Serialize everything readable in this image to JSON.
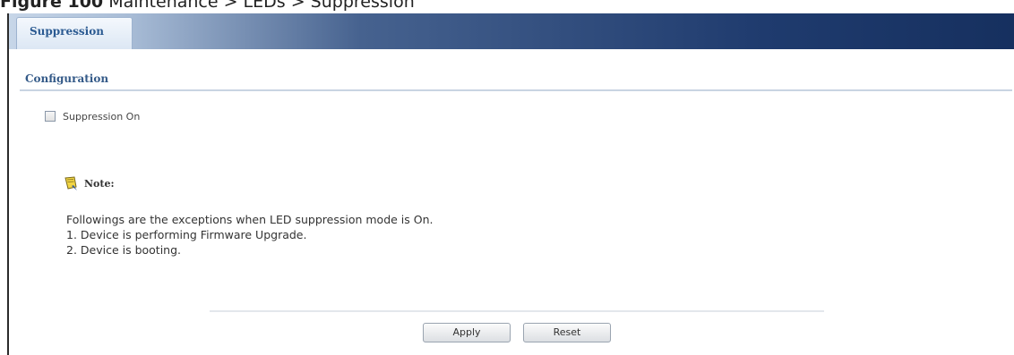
{
  "caption": {
    "figure_label": "Figure 100",
    "path_text": "Maintenance > LEDs > Suppression"
  },
  "tabs": [
    {
      "label": "Suppression",
      "active": true
    }
  ],
  "section": {
    "title": "Configuration"
  },
  "form": {
    "suppression_checkbox": {
      "label": "Suppression On",
      "checked": false
    }
  },
  "note": {
    "title": "Note:",
    "icon": "note-icon",
    "lines": [
      "Followings are the exceptions when LED suppression mode is On.",
      "1. Device is performing Firmware Upgrade.",
      "2. Device is booting."
    ]
  },
  "buttons": {
    "apply_label": "Apply",
    "reset_label": "Reset"
  },
  "colors": {
    "tabbar_dark": "#1f3b6e",
    "tab_text": "#2b5a92",
    "section_title": "#345a88"
  }
}
